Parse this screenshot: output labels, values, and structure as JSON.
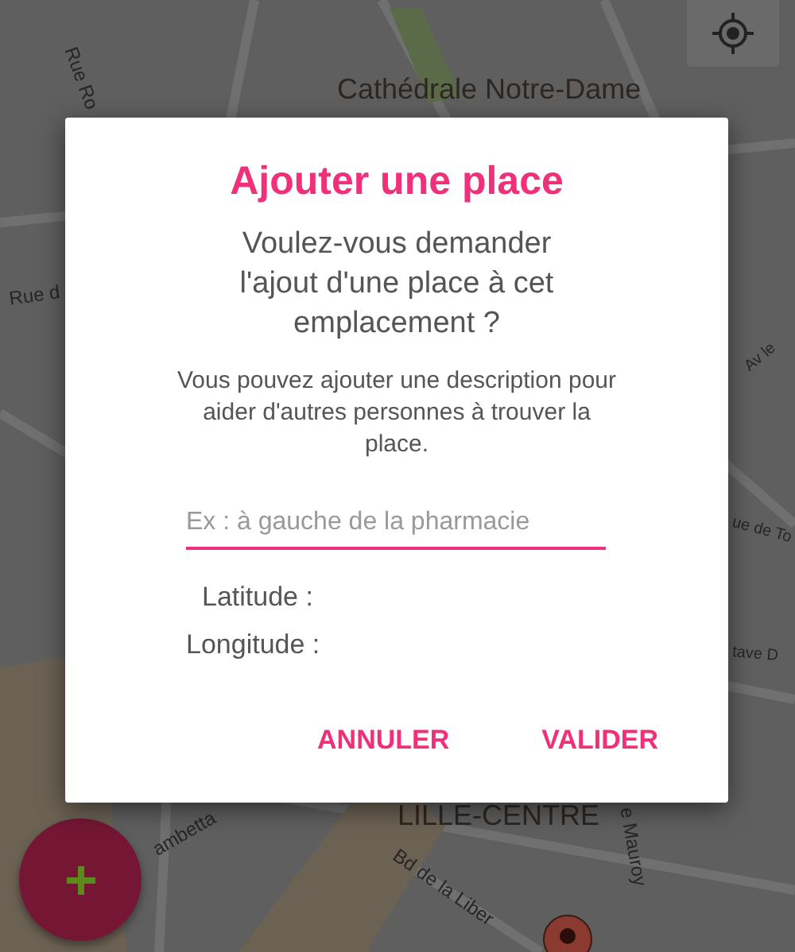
{
  "map": {
    "labels": [
      {
        "text": "Rue Ro",
        "kind": "street"
      },
      {
        "text": "Cathédrale Notre-Dame",
        "kind": "place"
      },
      {
        "text": "Rue d",
        "kind": "street"
      },
      {
        "text": "Av le",
        "kind": "street"
      },
      {
        "text": "ue de To",
        "kind": "street"
      },
      {
        "text": "tave D",
        "kind": "street"
      },
      {
        "text": "ambetta",
        "kind": "street"
      },
      {
        "text": "LILLE-CENTRE",
        "kind": "place"
      },
      {
        "text": "e Mauroy",
        "kind": "street"
      },
      {
        "text": "Bd de la Liber",
        "kind": "street"
      }
    ]
  },
  "dialog": {
    "title": "Ajouter une place",
    "question": "Voulez-vous demander l'ajout d'une place à cet emplacement ?",
    "hint": "Vous pouvez ajouter une description pour aider d'autres personnes à trouver la place.",
    "field": {
      "placeholder": "Ex : à gauche de la pharmacie"
    },
    "coords": [
      {
        "label": "Latitude :"
      },
      {
        "label": "Longitude :"
      }
    ],
    "buttons": [
      "ANNULER",
      "VALIDER"
    ]
  }
}
